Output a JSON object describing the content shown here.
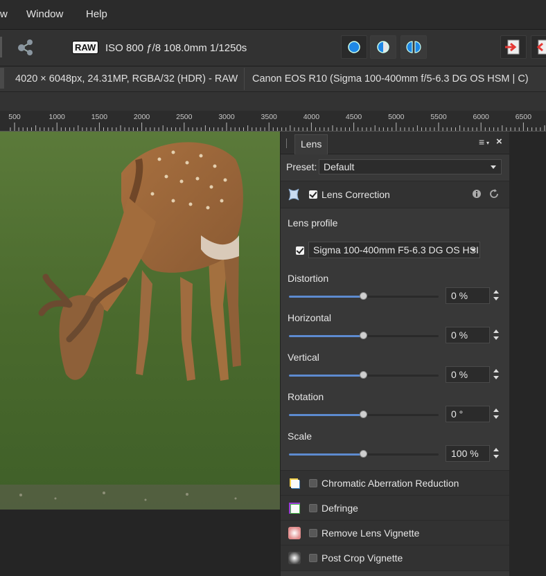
{
  "menubar": {
    "items": [
      "w",
      "Window",
      "Help"
    ]
  },
  "toolbar": {
    "raw_badge": "RAW",
    "exif": "ISO 800 ƒ/8 108.0mm 1/1250s"
  },
  "infobar": {
    "image_info": "4020 × 6048px, 24.31MP, RGBA/32 (HDR) - RAW",
    "camera_info": "Canon EOS R10 (Sigma 100-400mm f/5-6.3 DG OS HSM | C)"
  },
  "ruler": {
    "ticks": [
      "500",
      "1000",
      "1500",
      "2000",
      "2500",
      "3000",
      "3500",
      "4000",
      "4500",
      "5000",
      "5500",
      "6000",
      "6500"
    ]
  },
  "panel": {
    "tab": "Lens",
    "preset_label": "Preset:",
    "preset_value": "Default",
    "lens_correction": {
      "label": "Lens Correction",
      "checked": true
    },
    "lens_profile_label": "Lens profile",
    "lens_profile_value": "Sigma 100-400mm F5-6.3 DG OS HSI",
    "sliders": [
      {
        "label": "Distortion",
        "value": "0 %",
        "level": 0.5
      },
      {
        "label": "Horizontal",
        "value": "0 %",
        "level": 0.5
      },
      {
        "label": "Vertical",
        "value": "0 %",
        "level": 0.5
      },
      {
        "label": "Rotation",
        "value": "0 °",
        "level": 0.5
      },
      {
        "label": "Scale",
        "value": "100 %",
        "level": 0.5
      }
    ],
    "sections": [
      {
        "label": "Chromatic Aberration Reduction",
        "checked": false
      },
      {
        "label": "Defringe",
        "checked": false
      },
      {
        "label": "Remove Lens Vignette",
        "checked": false
      },
      {
        "label": "Post Crop Vignette",
        "checked": false
      }
    ]
  },
  "colors": {
    "accent": "#5d8bd0",
    "panel_bg": "#383838",
    "grass": "#4c6a2f"
  }
}
